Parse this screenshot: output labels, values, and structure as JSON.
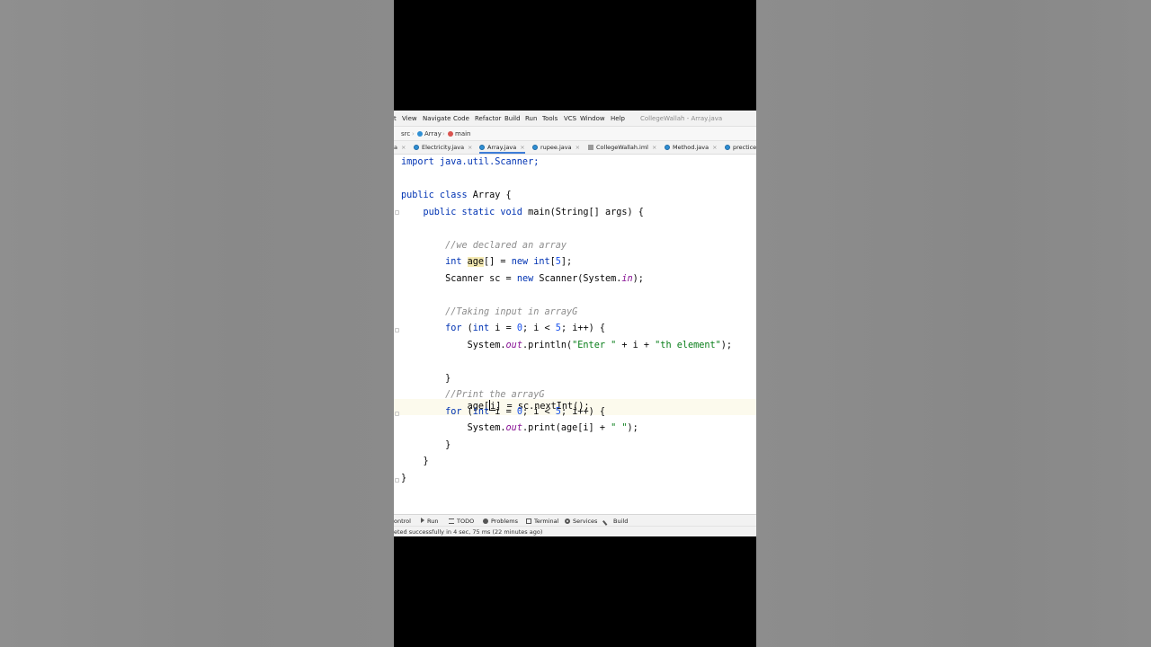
{
  "window": {
    "menu": [
      "t",
      "View",
      "Navigate",
      "Code",
      "Refactor",
      "Build",
      "Run",
      "Tools",
      "VCS",
      "Window",
      "Help"
    ],
    "title": "CollegeWallah - Array.java"
  },
  "breadcrumb": {
    "root": "src",
    "class": "Array",
    "method": "main"
  },
  "tabs": [
    {
      "label": "a",
      "active": false
    },
    {
      "label": "Electricity.java",
      "active": false
    },
    {
      "label": "Array.java",
      "active": true
    },
    {
      "label": "rupee.java",
      "active": false
    },
    {
      "label": "CollegeWallah.iml",
      "active": false
    },
    {
      "label": "Method.java",
      "active": false
    },
    {
      "label": "precticec",
      "active": false
    }
  ],
  "tab_close": "×",
  "code": {
    "l1": "import java.util.Scanner;",
    "l3_a": "public class ",
    "l3_b": "Array {",
    "l4_a": "    public static void ",
    "l4_b": "main(String[] args) {",
    "l6": "        //we declared an array",
    "l7_kw": "        int ",
    "l7_var": "age",
    "l7_rest1": "[] = ",
    "l7_new": "new int",
    "l7_rest2": "[",
    "l7_num": "5",
    "l7_rest3": "];",
    "l8_a": "        Scanner sc = ",
    "l8_new": "new ",
    "l8_b": "Scanner(System.",
    "l8_in": "in",
    "l8_c": ");",
    "l10": "        //Taking input in arrayG",
    "l11_for": "        for ",
    "l11_a": "(",
    "l11_int": "int ",
    "l11_b": "i = ",
    "l11_n0": "0",
    "l11_c": "; i < ",
    "l11_n5": "5",
    "l11_d": "; i++) {",
    "l12_a": "            System.",
    "l12_out": "out",
    "l12_b": ".println(",
    "l12_s1": "\"Enter \"",
    "l12_c": " + i + ",
    "l12_s2": "\"th element\"",
    "l12_d": ");",
    "l13_a": "            age[",
    "l13_i": "i",
    "l13_b": "] = sc.nextInt();",
    "l14": "        }",
    "l15": "        //Print the arrayG",
    "l16_for": "        for ",
    "l16_a": "(",
    "l16_int": "int ",
    "l16_b": "i = ",
    "l16_n0": "0",
    "l16_c": "; i < ",
    "l16_n5": "5",
    "l16_d": "; i++) {",
    "l17_a": "            System.",
    "l17_out": "out",
    "l17_b": ".print(age[i] + ",
    "l17_s": "\" \"",
    "l17_c": ");",
    "l18": "        }",
    "l19": "    }",
    "l20": "}"
  },
  "toolwindows": [
    "ontrol",
    "Run",
    "TODO",
    "Problems",
    "Terminal",
    "Services",
    "Build"
  ],
  "status": "eted successfully in 4 sec, 75 ms (22 minutes ago)",
  "colors": {
    "keyword": "#0033b3",
    "comment": "#8c8c8c",
    "string": "#067d17",
    "number": "#1750eb",
    "static_field": "#871094",
    "highlight": "#f5eab3"
  }
}
